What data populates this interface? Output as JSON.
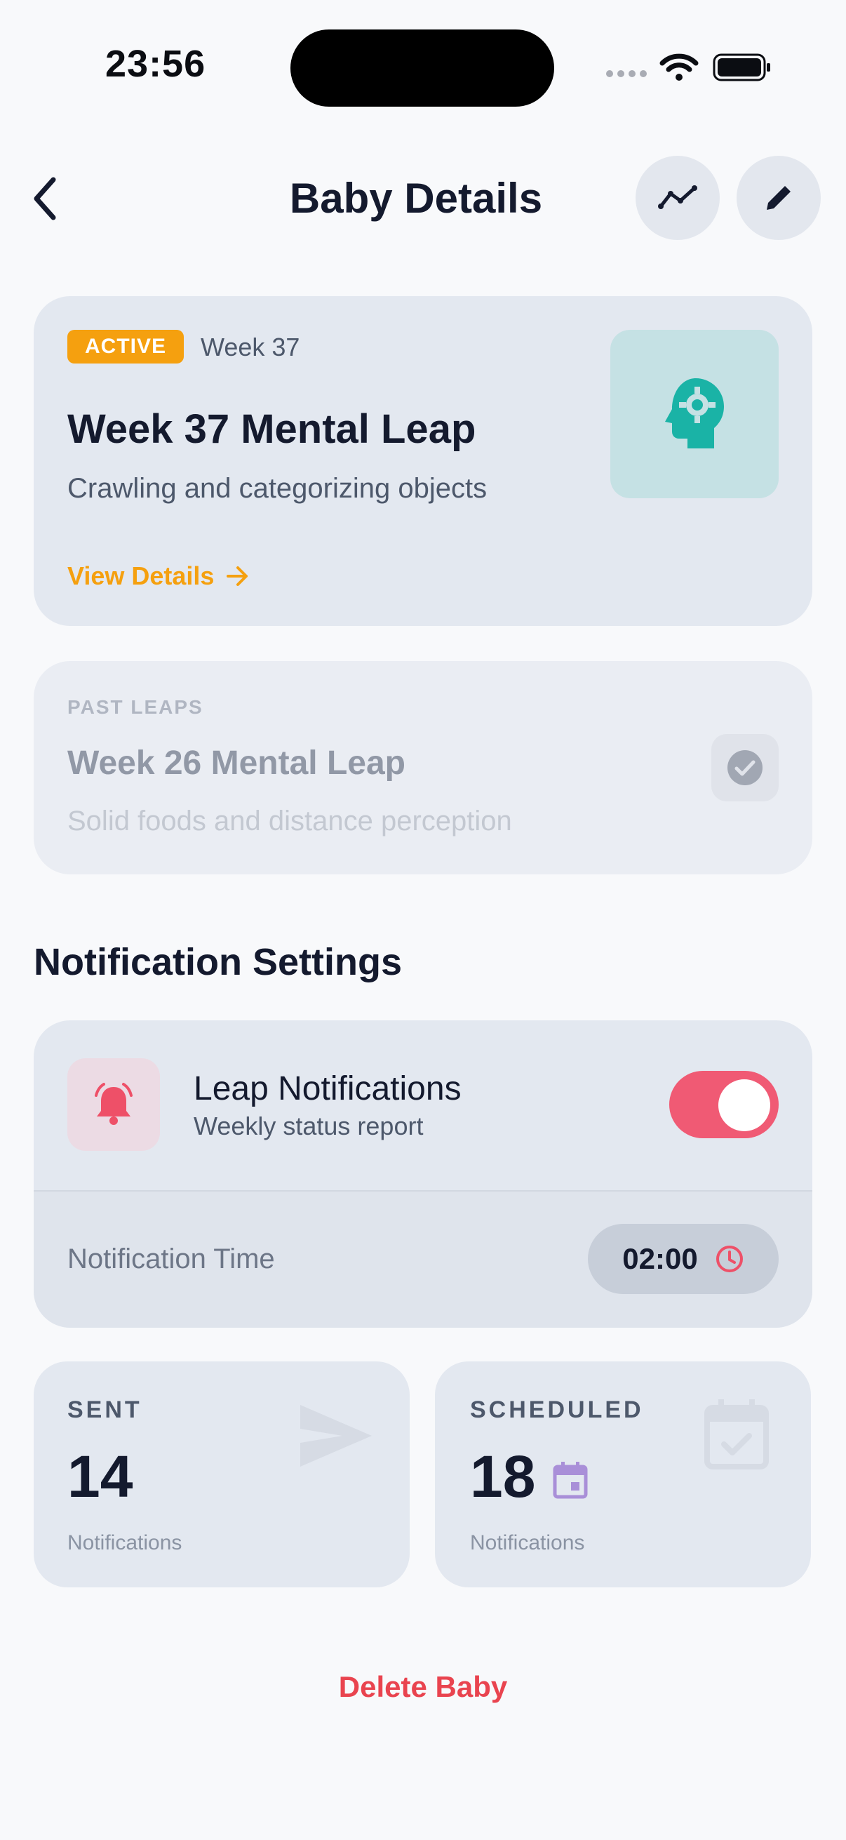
{
  "status_bar": {
    "time": "23:56"
  },
  "header": {
    "title": "Baby Details"
  },
  "active_leap": {
    "badge": "ACTIVE",
    "week": "Week 37",
    "title": "Week 37 Mental Leap",
    "subtitle": "Crawling and categorizing objects",
    "link": "View Details"
  },
  "past_leaps": {
    "label": "PAST LEAPS",
    "title": "Week 26 Mental Leap",
    "subtitle": "Solid foods and distance perception"
  },
  "notification_settings": {
    "section_title": "Notification Settings",
    "title": "Leap Notifications",
    "subtitle": "Weekly status report",
    "enabled": true,
    "time_label": "Notification Time",
    "time_value": "02:00"
  },
  "stats": {
    "sent": {
      "label": "SENT",
      "value": "14",
      "foot": "Notifications"
    },
    "scheduled": {
      "label": "SCHEDULED",
      "value": "18",
      "foot": "Notifications"
    }
  },
  "delete_label": "Delete Baby",
  "colors": {
    "accent": "#f5a00f",
    "toggle_on": "#f05a74",
    "danger": "#e9444f",
    "teal": "#1ab3a6",
    "purple": "#a98fd8"
  }
}
